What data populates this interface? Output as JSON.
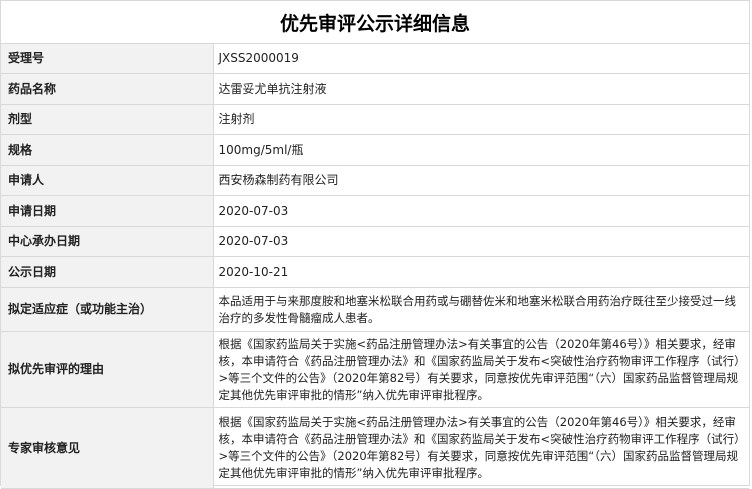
{
  "page": {
    "title": "优先审评公示详细信息"
  },
  "rows": [
    {
      "label": "受理号",
      "value": "JXSS2000019"
    },
    {
      "label": "药品名称",
      "value": "达雷妥尤单抗注射液"
    },
    {
      "label": "剂型",
      "value": "注射剂"
    },
    {
      "label": "规格",
      "value": "100mg/5ml/瓶"
    },
    {
      "label": "申请人",
      "value": "西安杨森制药有限公司"
    },
    {
      "label": "申请日期",
      "value": "2020-07-03"
    },
    {
      "label": "中心承办日期",
      "value": "2020-07-03"
    },
    {
      "label": "公示日期",
      "value": "2020-10-21"
    },
    {
      "label": "拟定适应症（或功能主治）",
      "value": "本品适用于与来那度胺和地塞米松联合用药或与硼替佐米和地塞米松联合用药治疗既往至少接受过一线治疗的多发性骨髓瘤成人患者。"
    },
    {
      "label": "拟优先审评的理由",
      "value": "根据《国家药监局关于实施<药品注册管理办法>有关事宜的公告（2020年第46号）》相关要求，经审核，本申请符合《药品注册管理办法》和《国家药监局关于发布<突破性治疗药物审评工作程序（试行）>等三个文件的公告》（2020年第82号）有关要求，同意按优先审评范围“（六）国家药品监督管理局规定其他优先审评审批的情形”纳入优先审评审批程序。"
    },
    {
      "label": "专家审核意见",
      "value": "根据《国家药监局关于实施<药品注册管理办法>有关事宜的公告（2020年第46号）》相关要求，经审核，本申请符合《药品注册管理办法》和《国家药监局关于发布<突破性治疗药物审评工作程序（试行）>等三个文件的公告》（2020年第82号）有关要求，同意按优先审评范围“（六）国家药品监督管理局规定其他优先审评审批的情形”纳入优先审评审批程序。"
    }
  ]
}
